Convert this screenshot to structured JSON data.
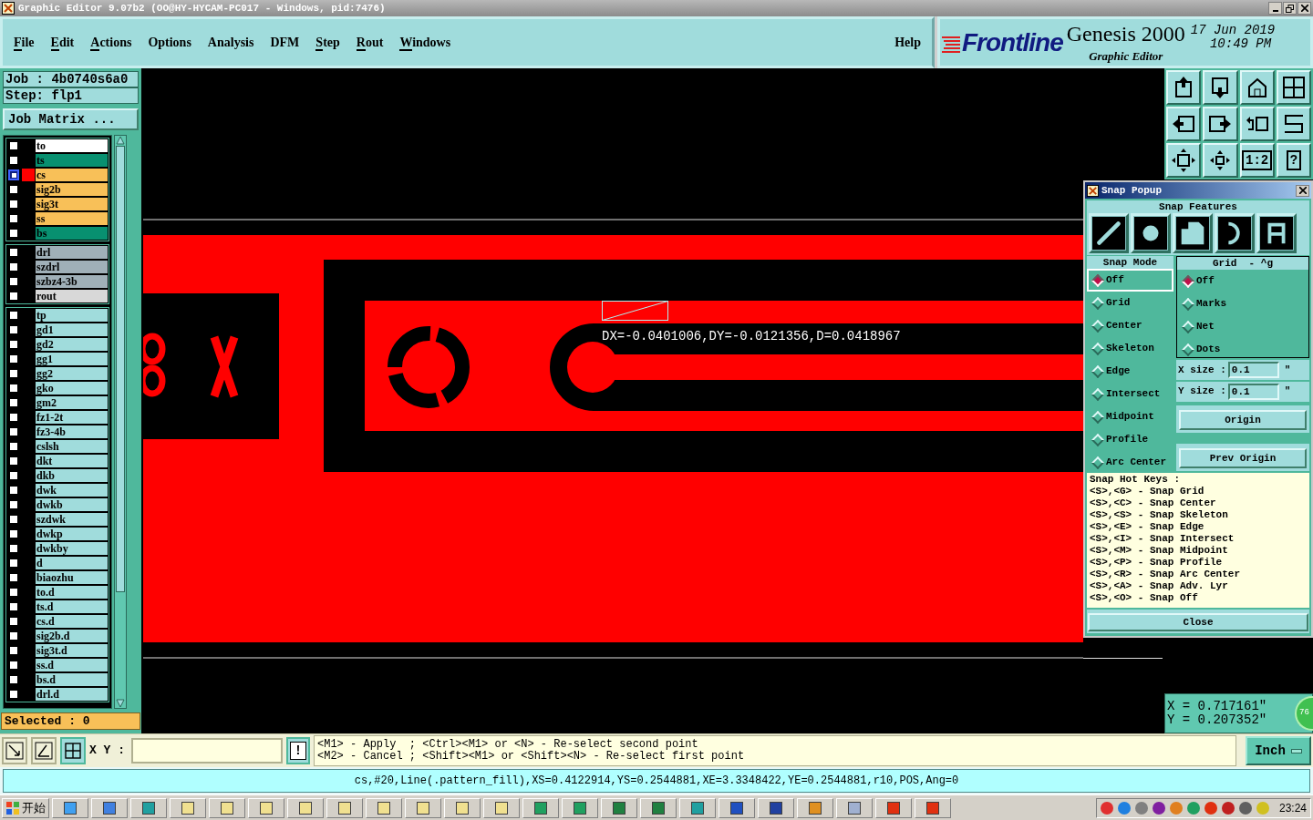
{
  "title_bar": {
    "title": "Graphic Editor 9.07b2 (OO@HY-HYCAM-PC017 - Windows, pid:7476)"
  },
  "menu": [
    {
      "label": "File",
      "mnemonic": true
    },
    {
      "label": "Edit",
      "mnemonic": true
    },
    {
      "label": "Actions",
      "mnemonic": true
    },
    {
      "label": "Options",
      "mnemonic": false
    },
    {
      "label": "Analysis",
      "mnemonic": false
    },
    {
      "label": "DFM",
      "mnemonic": false
    },
    {
      "label": "Step",
      "mnemonic": true
    },
    {
      "label": "Rout",
      "mnemonic": true
    },
    {
      "label": "Windows",
      "mnemonic": true
    }
  ],
  "help": "Help",
  "brand": {
    "logo": "Frontline",
    "product": "Genesis 2000",
    "subtitle": "Graphic Editor",
    "date": "17 Jun 2019",
    "time": "10:49 PM"
  },
  "job": {
    "job": "Job : 4b0740s6a0",
    "step": "Step: flp1",
    "matrix_button": "Job Matrix ..."
  },
  "layer_groups": [
    {
      "layers": [
        {
          "name": "to",
          "color": "#ffffff",
          "selected": false
        },
        {
          "name": "ts",
          "color": "#089070",
          "selected": false
        },
        {
          "name": "cs",
          "color": "#f8c058",
          "selected": true
        },
        {
          "name": "sig2b",
          "color": "#f8c058",
          "selected": false
        },
        {
          "name": "sig3t",
          "color": "#f8c058",
          "selected": false
        },
        {
          "name": "ss",
          "color": "#f8c058",
          "selected": false
        },
        {
          "name": "bs",
          "color": "#089070",
          "selected": false
        }
      ]
    },
    {
      "layers": [
        {
          "name": "drl",
          "color": "#a0b0b8",
          "selected": false
        },
        {
          "name": "szdrl",
          "color": "#a0b0b8",
          "selected": false
        },
        {
          "name": "szbz4-3b",
          "color": "#a0b0b8",
          "selected": false
        },
        {
          "name": "rout",
          "color": "#d8d8d8",
          "selected": false
        }
      ]
    },
    {
      "layers": [
        {
          "name": "tp",
          "color": "#a0dcdc",
          "selected": false
        },
        {
          "name": "gd1",
          "color": "#a0dcdc",
          "selected": false
        },
        {
          "name": "gd2",
          "color": "#a0dcdc",
          "selected": false
        },
        {
          "name": "gg1",
          "color": "#a0dcdc",
          "selected": false
        },
        {
          "name": "gg2",
          "color": "#a0dcdc",
          "selected": false
        },
        {
          "name": "gko",
          "color": "#a0dcdc",
          "selected": false
        },
        {
          "name": "gm2",
          "color": "#a0dcdc",
          "selected": false
        },
        {
          "name": "fz1-2t",
          "color": "#a0dcdc",
          "selected": false
        },
        {
          "name": "fz3-4b",
          "color": "#a0dcdc",
          "selected": false
        },
        {
          "name": "cslsh",
          "color": "#a0dcdc",
          "selected": false
        },
        {
          "name": "dkt",
          "color": "#a0dcdc",
          "selected": false
        },
        {
          "name": "dkb",
          "color": "#a0dcdc",
          "selected": false
        },
        {
          "name": "dwk",
          "color": "#a0dcdc",
          "selected": false
        },
        {
          "name": "dwkb",
          "color": "#a0dcdc",
          "selected": false
        },
        {
          "name": "szdwk",
          "color": "#a0dcdc",
          "selected": false
        },
        {
          "name": "dwkp",
          "color": "#a0dcdc",
          "selected": false
        },
        {
          "name": "dwkby",
          "color": "#a0dcdc",
          "selected": false
        },
        {
          "name": "d",
          "color": "#a0dcdc",
          "selected": false
        },
        {
          "name": "biaozhu",
          "color": "#a0dcdc",
          "selected": false
        },
        {
          "name": "to.d",
          "color": "#a0dcdc",
          "selected": false
        },
        {
          "name": "ts.d",
          "color": "#a0dcdc",
          "selected": false
        },
        {
          "name": "cs.d",
          "color": "#a0dcdc",
          "selected": false
        },
        {
          "name": "sig2b.d",
          "color": "#a0dcdc",
          "selected": false
        },
        {
          "name": "sig3t.d",
          "color": "#a0dcdc",
          "selected": false
        },
        {
          "name": "ss.d",
          "color": "#a0dcdc",
          "selected": false
        },
        {
          "name": "bs.d",
          "color": "#a0dcdc",
          "selected": false
        },
        {
          "name": "drl.d",
          "color": "#a0dcdc",
          "selected": false
        }
      ]
    }
  ],
  "selected_count": "Selected : 0",
  "view_buttons": [
    {
      "kind": "up"
    },
    {
      "kind": "down"
    },
    {
      "kind": "home"
    },
    {
      "kind": "grid"
    },
    {
      "kind": "left"
    },
    {
      "kind": "right"
    },
    {
      "kind": "undo"
    },
    {
      "kind": "snake"
    },
    {
      "kind": "fit"
    },
    {
      "kind": "zoom"
    },
    {
      "kind": "text",
      "label": "1:2"
    },
    {
      "kind": "text",
      "label": "?"
    }
  ],
  "canvas": {
    "measurement": "DX=-0.0401006,DY=-0.0121356,D=0.0418967"
  },
  "coordinates": {
    "x": "X = 0.717161\"",
    "y": "Y = 0.207352\"",
    "badge": "76"
  },
  "snap_popup": {
    "title": "Snap Popup",
    "features_heading": "Snap Features",
    "mode_heading": "Snap Mode",
    "modes": [
      {
        "label": "Off",
        "selected": true
      },
      {
        "label": "Grid",
        "selected": false
      },
      {
        "label": "Center",
        "selected": false
      },
      {
        "label": "Skeleton",
        "selected": false
      },
      {
        "label": "Edge",
        "selected": false
      },
      {
        "label": "Intersect",
        "selected": false
      },
      {
        "label": "Midpoint",
        "selected": false
      },
      {
        "label": "Profile",
        "selected": false
      },
      {
        "label": "Arc Center",
        "selected": false
      }
    ],
    "grid_heading": "Grid  - ^g",
    "grid_options": [
      {
        "label": "Off",
        "selected": true
      },
      {
        "label": "Marks",
        "selected": false
      },
      {
        "label": "Net",
        "selected": false
      },
      {
        "label": "Dots",
        "selected": false
      }
    ],
    "x_size": {
      "label": "X size :",
      "value": "0.1",
      "unit": "\""
    },
    "y_size": {
      "label": "Y size :",
      "value": "0.1",
      "unit": "\""
    },
    "origin_button": "Origin",
    "prev_origin_button": "Prev Origin",
    "hotkeys_heading": "Snap Hot Keys :",
    "hotkeys": [
      "<S>,<G> - Snap Grid",
      "<S>,<C> - Snap Center",
      "<S>,<S> - Snap Skeleton",
      "<S>,<E> - Snap Edge",
      "<S>,<I> - Snap Intersect",
      "<S>,<M> - Snap Midpoint",
      "<S>,<P> - Snap Profile",
      "<S>,<R> - Snap Arc Center",
      "<S>,<A> - Snap Adv. Lyr",
      "<S>,<O> - Snap Off"
    ],
    "close_button": "Close"
  },
  "command_bar": {
    "xy_label": "X Y :",
    "action_button": "!",
    "messages": [
      "<M1> - Apply  ; <Ctrl><M1> or <N> - Re-select second point",
      "<M2> - Cancel ; <Shift><M1> or <Shift><N> - Re-select first point"
    ],
    "units": "Inch"
  },
  "status_line": "cs,#20,Line(.pattern_fill),XS=0.4122914,YS=0.2544881,XE=3.3348422,YE=0.2544881,r10,POS,Ang=0",
  "taskbar": {
    "start": "开始",
    "clock": "23:24"
  }
}
